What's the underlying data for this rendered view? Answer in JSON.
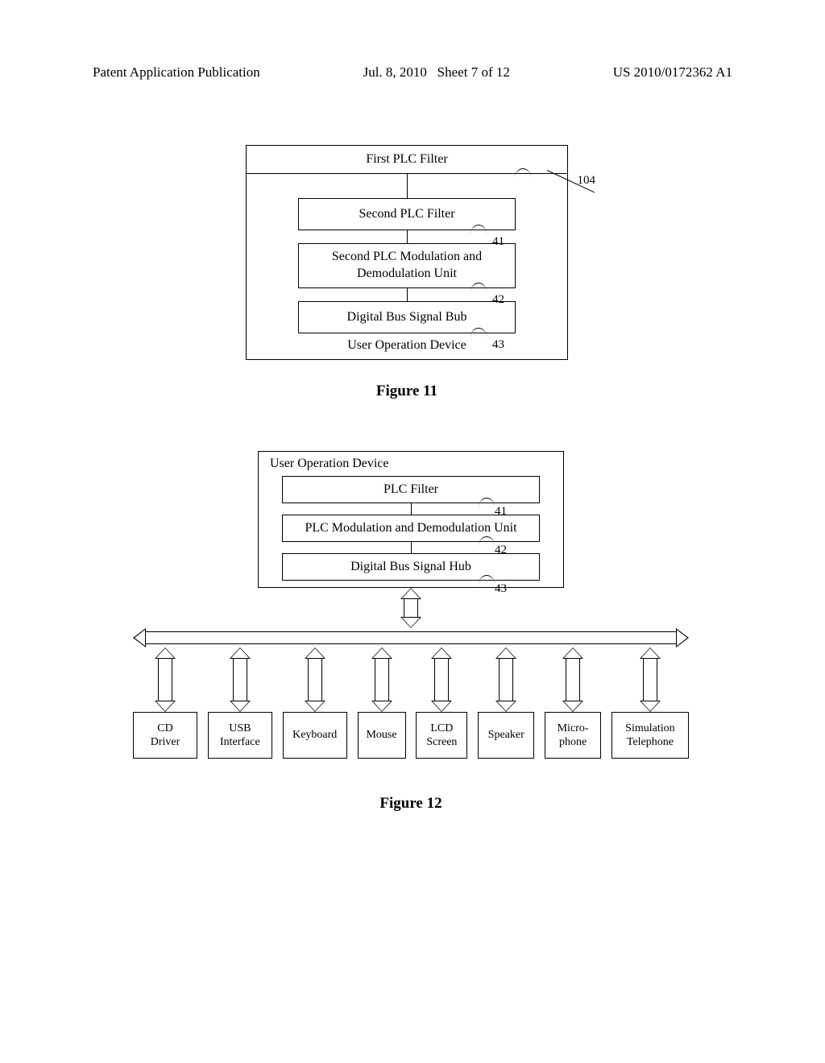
{
  "header": {
    "left": "Patent Application Publication",
    "middle": "Jul. 8, 2010   Sheet 7 of 12",
    "right": "US 2010/0172362 A1"
  },
  "figure11": {
    "caption": "Figure 11",
    "first_filter": "First PLC Filter",
    "ref_104": "104",
    "second_filter": "Second PLC Filter",
    "ref_41": "41",
    "modem": "Second PLC Modulation and",
    "modem_l2": "Demodulation Unit",
    "ref_42": "42",
    "hub": "Digital Bus Signal Bub",
    "ref_43": "43",
    "device_label": "User Operation Device"
  },
  "figure12": {
    "caption": "Figure 12",
    "device_title": "User Operation Device",
    "filter": "PLC Filter",
    "ref_41": "41",
    "modem": "PLC Modulation and Demodulation Unit",
    "ref_42": "42",
    "hub": "Digital Bus Signal Hub",
    "ref_43": "43",
    "peripherals": [
      "CD\nDriver",
      "USB\nInterface",
      "Keyboard",
      "Mouse",
      "LCD\nScreen",
      "Speaker",
      "Micro-\nphone",
      "Simulation\nTelephone"
    ]
  }
}
